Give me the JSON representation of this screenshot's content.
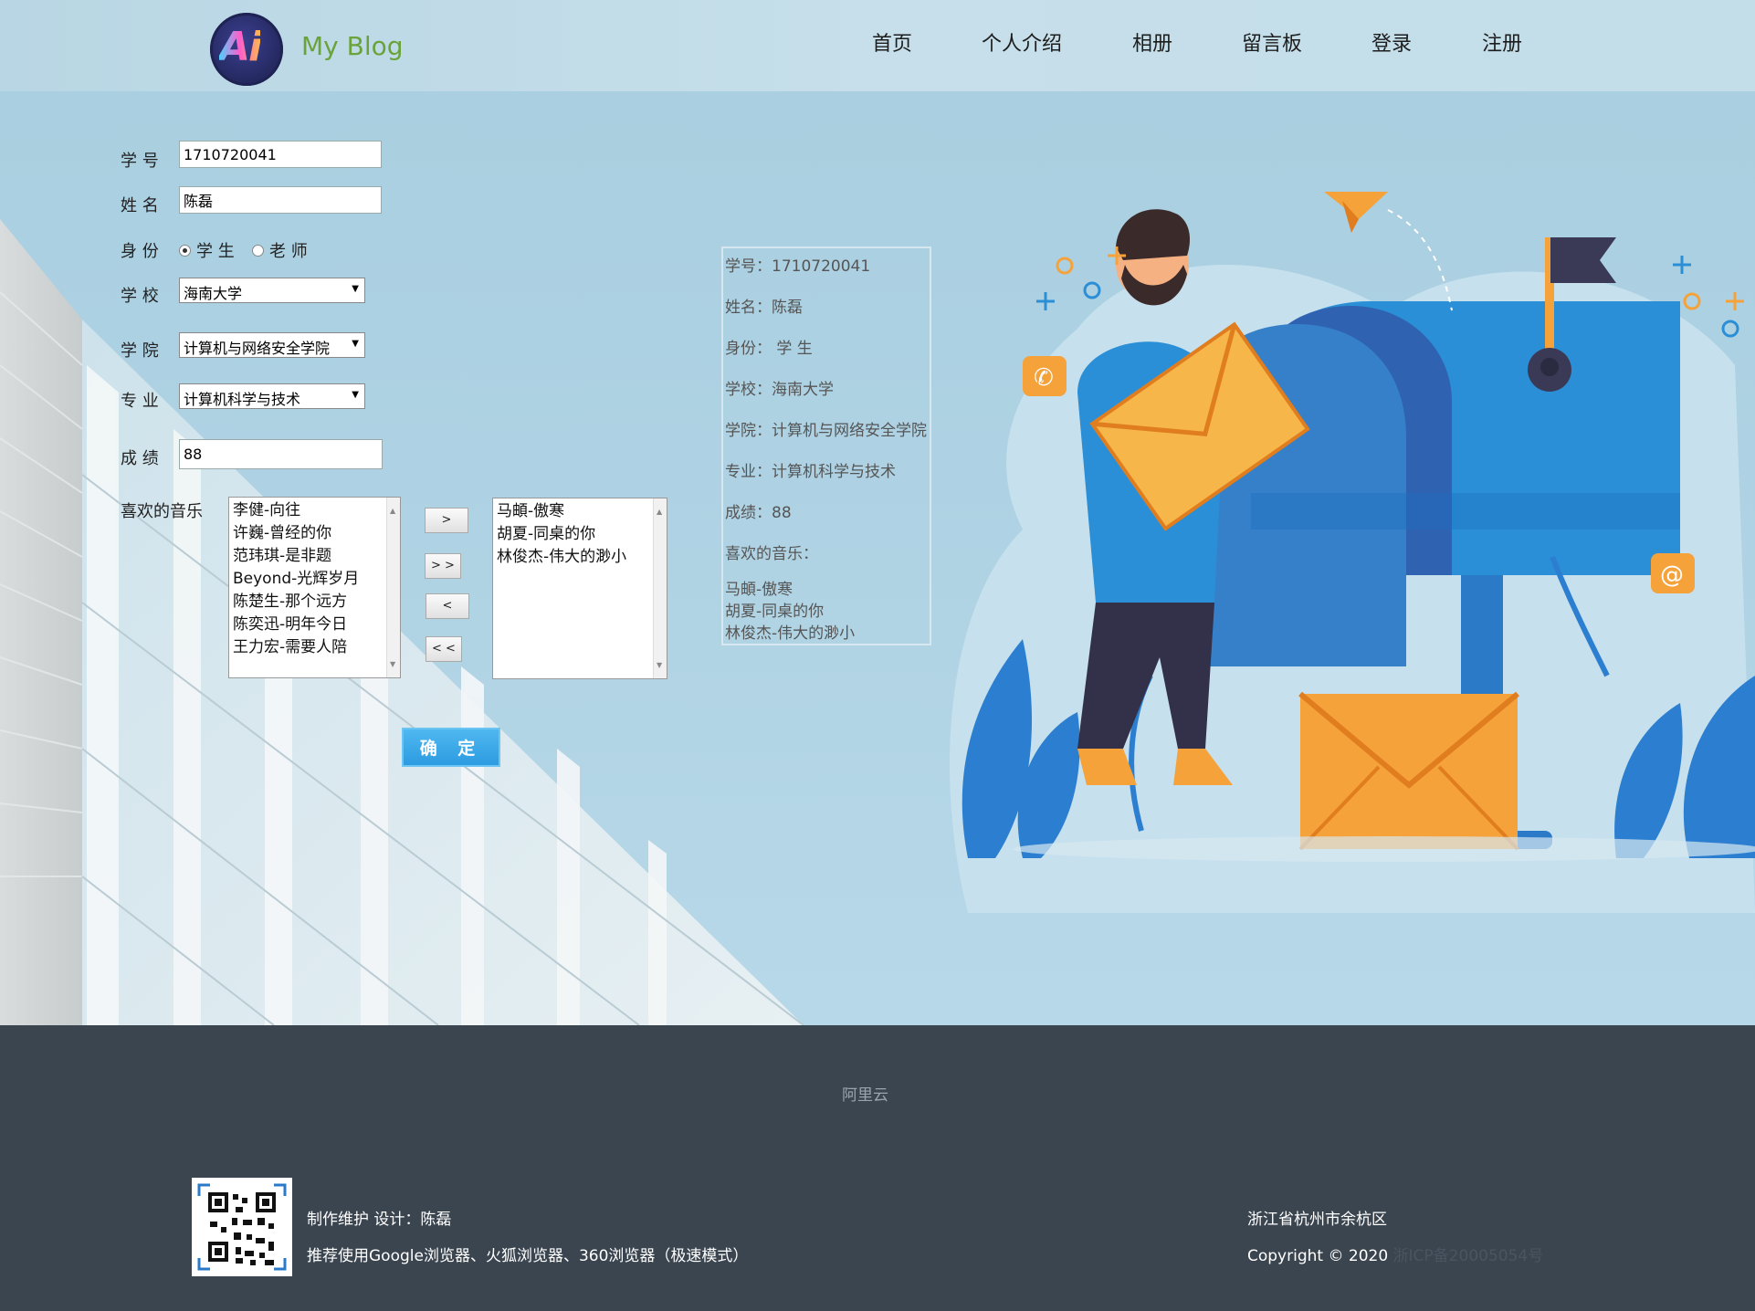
{
  "header": {
    "logo_text": "Ai",
    "site_title": "My Blog",
    "nav": [
      "首页",
      "个人介绍",
      "相册",
      "留言板",
      "登录",
      "注册"
    ]
  },
  "form": {
    "student_id_label": "学 号",
    "student_id_value": "1710720041",
    "name_label": "姓 名",
    "name_value": "陈磊",
    "identity_label": "身 份",
    "identity_student": "学 生",
    "identity_teacher": "老 师",
    "school_label": "学 校",
    "school_value": "海南大学",
    "college_label": "学 院",
    "college_value": "计算机与网络安全学院",
    "major_label": "专 业",
    "major_value": "计算机科学与技术",
    "score_label": "成 绩",
    "score_value": "88",
    "music_label": "喜欢的音乐",
    "music_available": [
      "李健-向往",
      "许巍-曾经的你",
      "范玮琪-是非题",
      "Beyond-光辉岁月",
      "陈楚生-那个远方",
      "陈奕迅-明年今日",
      "王力宏-需要人陪"
    ],
    "music_selected": [
      "马頔-傲寒",
      "胡夏-同桌的你",
      "林俊杰-伟大的渺小"
    ],
    "move_right_one": ">",
    "move_right_all": "> >",
    "move_left_one": "<",
    "move_left_all": "< <",
    "submit_label": "确 定"
  },
  "summary": {
    "id": "学号：1710720041",
    "name": "姓名：陈磊",
    "identity": "身份：  学 生",
    "school": "学校：海南大学",
    "college": "学院：计算机与网络安全学院",
    "major": "专业：计算机科学与技术",
    "score": "成绩：88",
    "music_title": "喜欢的音乐：",
    "music": [
      "马頔-傲寒",
      "胡夏-同桌的你",
      "林俊杰-伟大的渺小"
    ]
  },
  "footer": {
    "aliyun": "阿里云",
    "maintain": "制作维护 设计：陈磊",
    "browsers": "推荐使用Google浏览器、火狐浏览器、360浏览器（极速模式）",
    "address": "浙江省杭州市余杭区",
    "copyright": "Copyright © 2020",
    "icp": "浙ICP备20005054号"
  },
  "colors": {
    "footer_bg": "#3b4550",
    "button_blue": "#2c9be0",
    "mailbox_blue": "#2a8fd6",
    "envelope_orange": "#f5a23a"
  }
}
